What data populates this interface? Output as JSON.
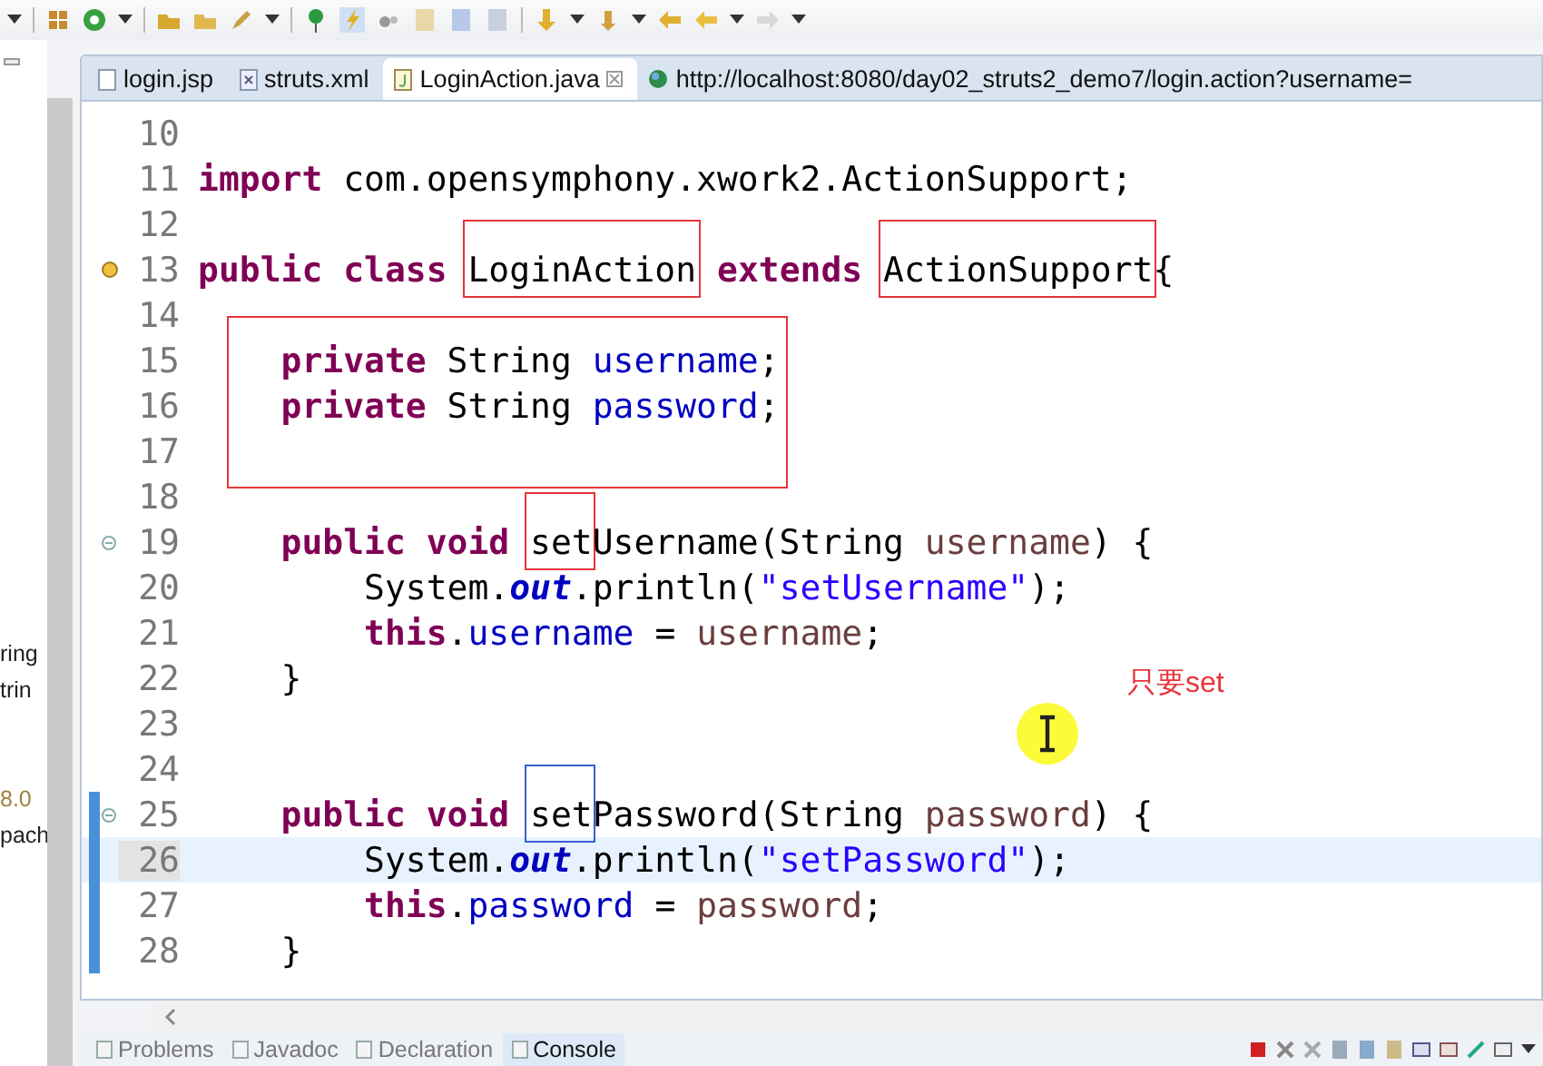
{
  "side_panel": {
    "texts": [
      {
        "text": "ring",
        "color": "#222222"
      },
      {
        "text": "trin",
        "color": "#222222"
      },
      {
        "text": "8.0",
        "color": "#a08040"
      },
      {
        "text": "pach",
        "color": "#222222"
      }
    ]
  },
  "editor_tabs": [
    {
      "label": "login.jsp",
      "kind": "file",
      "selected": false
    },
    {
      "label": "struts.xml",
      "kind": "xml",
      "selected": false
    },
    {
      "label": "LoginAction.java",
      "kind": "java",
      "selected": true
    },
    {
      "label": "http://localhost:8080/day02_struts2_demo7/login.action?username=",
      "kind": "web",
      "selected": false
    }
  ],
  "code_lines": [
    {
      "kind": "line",
      "number": "10"
    },
    {
      "kind": "line",
      "number": "11",
      "tokens": [
        {
          "text": "import",
          "kind": "keyword"
        },
        {
          "text": " com.opensymphony.xwork2.ActionSupport;",
          "kind": "plain"
        }
      ]
    },
    {
      "kind": "line",
      "number": "12"
    },
    {
      "kind": "line",
      "number": "13",
      "warning": true,
      "tokens": [
        {
          "text": "public class ",
          "kind": "keyword"
        },
        {
          "text": "LoginAction",
          "kind": "plain",
          "frame": {
            "color": "#e8343a"
          }
        },
        {
          "text": " extends ",
          "kind": "keyword"
        },
        {
          "text": "ActionSupport",
          "kind": "plain",
          "frame": {
            "color": "#e8343a"
          }
        },
        {
          "text": "{",
          "kind": "plain"
        }
      ]
    },
    {
      "kind": "line",
      "number": "14"
    },
    {
      "kind": "group",
      "frame": {
        "color": "#e8343a"
      },
      "lines": [
        {
          "kind": "line",
          "number": "15",
          "tokens": [
            {
              "text": "    private",
              "kind": "keyword"
            },
            {
              "text": " String ",
              "kind": "plain"
            },
            {
              "text": "username",
              "kind": "field"
            },
            {
              "text": ";",
              "kind": "plain"
            }
          ]
        },
        {
          "kind": "line",
          "number": "16",
          "tokens": [
            {
              "text": "    private",
              "kind": "keyword"
            },
            {
              "text": " String ",
              "kind": "plain"
            },
            {
              "text": "password",
              "kind": "field"
            },
            {
              "text": ";",
              "kind": "plain"
            }
          ]
        },
        {
          "kind": "line",
          "number": "17"
        }
      ]
    },
    {
      "kind": "line",
      "number": "18"
    },
    {
      "kind": "line",
      "number": "19",
      "foldable": true,
      "tokens": [
        {
          "text": "    public void ",
          "kind": "keyword"
        },
        {
          "text": "set",
          "kind": "plain",
          "frame": {
            "color": "#e8343a"
          }
        },
        {
          "text": "Username(String ",
          "kind": "plain"
        },
        {
          "text": "username",
          "kind": "param"
        },
        {
          "text": ") {",
          "kind": "plain"
        }
      ]
    },
    {
      "kind": "line",
      "number": "20",
      "tokens": [
        {
          "text": "        System.",
          "kind": "plain"
        },
        {
          "text": "out",
          "kind": "static"
        },
        {
          "text": ".println(",
          "kind": "plain"
        },
        {
          "text": "\"setUsername\"",
          "kind": "string"
        },
        {
          "text": ");",
          "kind": "plain"
        }
      ]
    },
    {
      "kind": "line",
      "number": "21",
      "tokens": [
        {
          "text": "        this",
          "kind": "keyword"
        },
        {
          "text": ".",
          "kind": "plain"
        },
        {
          "text": "username",
          "kind": "field"
        },
        {
          "text": " = ",
          "kind": "plain"
        },
        {
          "text": "username",
          "kind": "param"
        },
        {
          "text": ";",
          "kind": "plain"
        }
      ]
    },
    {
      "kind": "line",
      "number": "22",
      "tokens": [
        {
          "text": "    }",
          "kind": "plain"
        }
      ]
    },
    {
      "kind": "line",
      "number": "23"
    },
    {
      "kind": "line",
      "number": "24"
    },
    {
      "kind": "line",
      "number": "25",
      "foldable": true,
      "changed": true,
      "tokens": [
        {
          "text": "    public void ",
          "kind": "keyword"
        },
        {
          "text": "set",
          "kind": "plain",
          "frame": {
            "color": "#3a5fd0"
          }
        },
        {
          "text": "Password(String ",
          "kind": "plain"
        },
        {
          "text": "password",
          "kind": "param"
        },
        {
          "text": ") {",
          "kind": "plain"
        }
      ]
    },
    {
      "kind": "line",
      "number": "26",
      "current": true,
      "changed": true,
      "tokens": [
        {
          "text": "        System.",
          "kind": "plain"
        },
        {
          "text": "out",
          "kind": "static"
        },
        {
          "text": ".println(",
          "kind": "plain"
        },
        {
          "text": "\"setPassword\"",
          "kind": "string"
        },
        {
          "text": ");",
          "kind": "plain"
        }
      ]
    },
    {
      "kind": "line",
      "number": "27",
      "changed": true,
      "tokens": [
        {
          "text": "        this",
          "kind": "keyword"
        },
        {
          "text": ".",
          "kind": "plain"
        },
        {
          "text": "password",
          "kind": "field"
        },
        {
          "text": " = ",
          "kind": "plain"
        },
        {
          "text": "password",
          "kind": "param"
        },
        {
          "text": ";",
          "kind": "plain"
        }
      ]
    },
    {
      "kind": "line",
      "number": "28",
      "changed": true,
      "tokens": [
        {
          "text": "    }",
          "kind": "plain"
        }
      ]
    }
  ],
  "annotation": {
    "text": "只要set"
  },
  "bottom_tabs": [
    {
      "label": "Problems",
      "selected": false
    },
    {
      "label": "Javadoc",
      "selected": false
    },
    {
      "label": "Declaration",
      "selected": false
    },
    {
      "label": "Console",
      "selected": true
    }
  ]
}
